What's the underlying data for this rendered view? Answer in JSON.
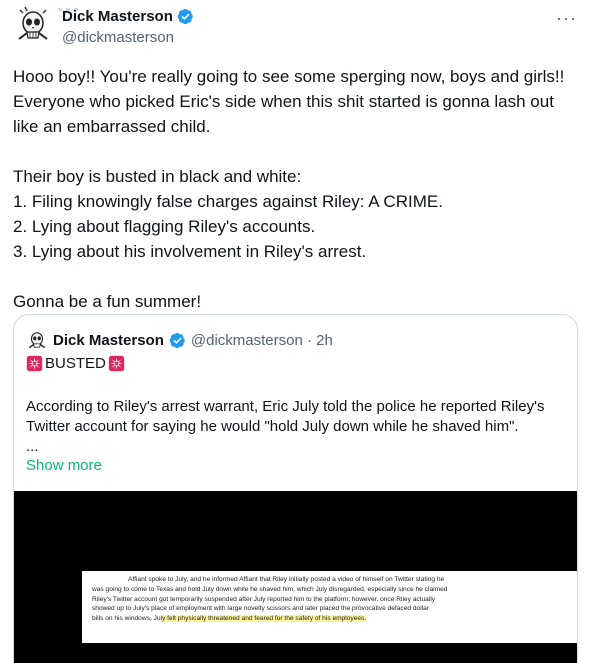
{
  "author": {
    "name": "Dick Masterson",
    "handle": "@dickmasterson"
  },
  "more_icon": "more-horizontal-icon",
  "tweet": {
    "lines": [
      "Hooo boy!! You're really going to see some sperging now, boys and girls!!",
      "Everyone who picked Eric's side when this shit started is gonna lash out",
      "like an embarrassed child.",
      "",
      "Their boy is busted in black and white:",
      "1. Filing knowingly false charges against Riley: A CRIME.",
      "2. Lying about flagging Riley's accounts.",
      "3. Lying about his involvement in Riley's arrest.",
      "",
      "Gonna be a fun summer!"
    ]
  },
  "quote": {
    "name": "Dick Masterson",
    "handle_time": "@dickmasterson · 2h",
    "busted": "BUSTED",
    "text_line1": "According to Riley's arrest warrant, Eric July told the police he reported Riley's",
    "text_line2": "Twitter account for saying he would \"hold July down while he shaved him\".",
    "ellipsis": "...",
    "show_more": "Show more",
    "document_lines": [
      "Affiant spoke to July, and he informed Affiant that Riley initially posted a video of himself on Twitter stating he",
      "was going to come to Texas and hold July down while he shaved him, which July disregarded, especially since he claimed",
      "Riley's Twitter account got temporarily suspended after July reported him to the platform; however, once Riley actually",
      "showed up to July's place of employment with large novelty scissors and later placed the provocative defaced dollar"
    ],
    "document_last_plain": "bills on his windows, Ju",
    "document_last_highlight": "ly felt physically threatened and feared for the safety of his employees."
  },
  "colors": {
    "verified": "#1d9bf0",
    "link": "#00ba7c",
    "secondary_text": "#536471",
    "border": "#cfd9de",
    "highlight": "#fff59a"
  }
}
